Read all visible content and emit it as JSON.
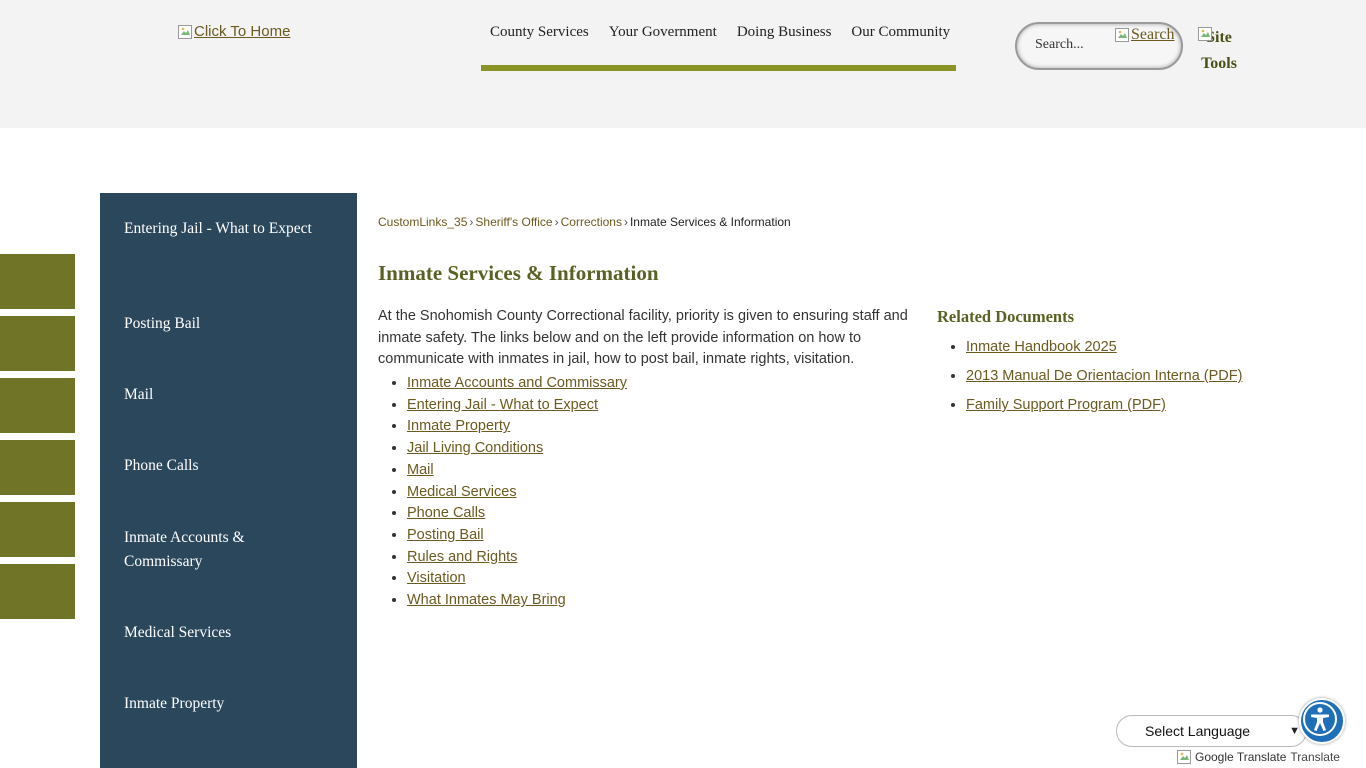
{
  "header": {
    "logo_alt": "Click To Home",
    "nav": [
      "County Services",
      "Your Government",
      "Doing Business",
      "Our Community"
    ],
    "search_placeholder": "Search...",
    "search_button_alt": "Search",
    "site_tools_alt": "Site Tools"
  },
  "sidebar": {
    "items": [
      "Entering Jail - What to Expect",
      "Posting Bail",
      "Mail",
      "Phone Calls",
      "Inmate Accounts & Commissary",
      "Medical Services",
      "Inmate Property"
    ]
  },
  "breadcrumb": {
    "items": [
      "CustomLinks_35",
      "Sheriff's Office",
      "Corrections"
    ],
    "current": "Inmate Services & Information",
    "separator": "›"
  },
  "main": {
    "title": "Inmate Services & Information",
    "intro": "At the Snohomish County Correctional facility, priority is given to ensuring staff and inmate safety. The links below and on the left provide information on how to communicate with inmates in jail, how to post bail, inmate rights, visitation.",
    "links": [
      "Inmate Accounts and Commissary",
      "Entering Jail - What to Expect",
      "Inmate Property",
      "Jail Living Conditions",
      "Mail",
      "Medical Services",
      "Phone Calls",
      "Posting Bail",
      "Rules and Rights",
      "Visitation",
      "What Inmates May Bring"
    ]
  },
  "related": {
    "title": "Related Documents",
    "docs": [
      "Inmate Handbook 2025",
      "2013 Manual De Orientacion Interna (PDF)",
      "Family Support Program (PDF)"
    ]
  },
  "footer": {
    "language_select": "Select Language",
    "translate_alt": "Google Translate",
    "translate_label": "Translate"
  },
  "colors": {
    "sidebar_bg": "#2a475c",
    "nav_underline": "#8a9424",
    "side_tab": "#6f7427",
    "title_green": "#5b6124",
    "link": "#6b5a1f",
    "accessibility_blue": "#1f6fb8"
  },
  "icons": {
    "broken_image": "broken-image-icon",
    "accessibility": "accessibility-icon",
    "chevron": "chevron-down-icon"
  }
}
